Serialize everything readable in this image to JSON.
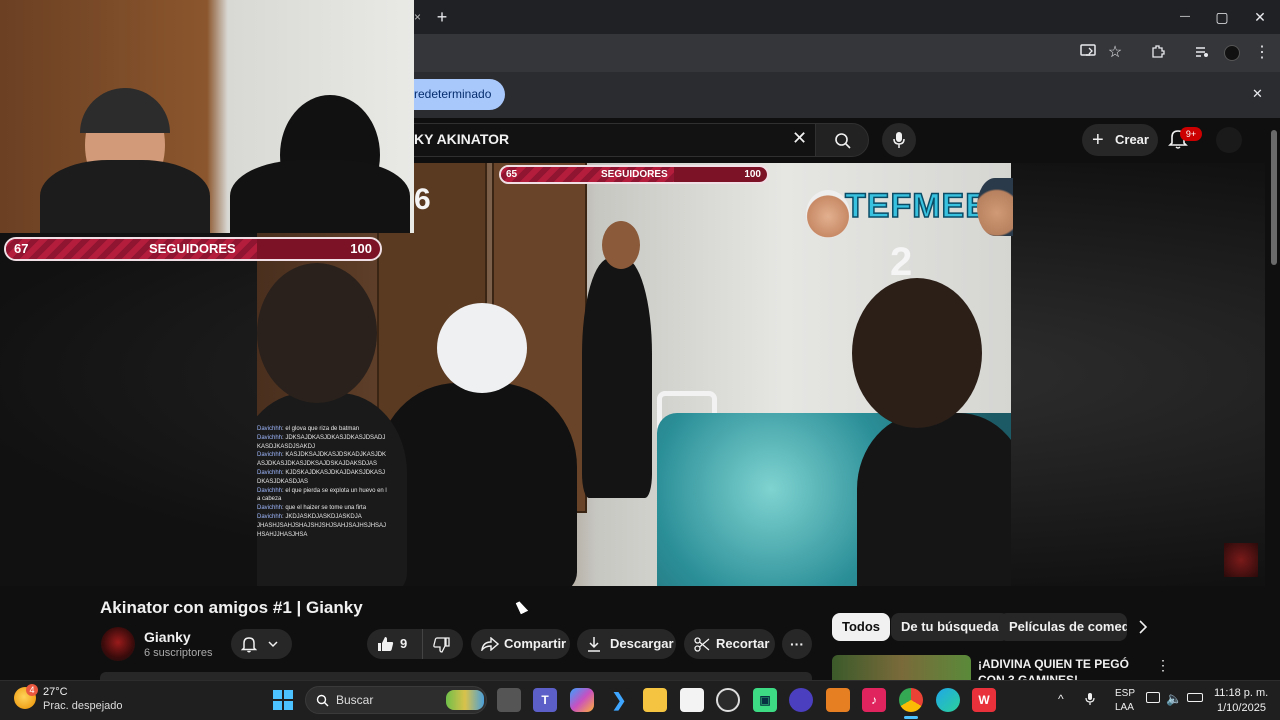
{
  "browser": {
    "new_tab_symbol": "+",
    "window_controls": {
      "minimize": "—",
      "maximize": "▢",
      "close": "✕"
    },
    "infobar_chip": "redeterminado",
    "infobar_close": "✕"
  },
  "youtube": {
    "search_query": "KY AKINATOR",
    "search_clear": "✕",
    "create_label": "Crear",
    "create_icon": "+",
    "notifications_badge": "9+"
  },
  "video": {
    "webcam_bar": {
      "left": "67",
      "label": "SEGUIDORES",
      "right": "100",
      "fill_fraction": 0.67
    },
    "scene_bar": {
      "left": "65",
      "label": "SEGUIDORES",
      "right": "100",
      "fill_fraction": 0.65
    },
    "overlay_tefmee": "TEFMEE",
    "overlay_2": "2",
    "overlay_6": "6",
    "chat": [
      {
        "name": "Davichhh",
        "msg": ": el glova que riza de batman"
      },
      {
        "name": "Davichhh",
        "msg": ": JDKSAJDKASJDKASJDKASJDSADJKASDJKASDJSAKDJ"
      },
      {
        "name": "Davichhh",
        "msg": ": KASJDKSAJDKASJDSKADJKASJDKASJDKASJDKASJDKSAJDSKAJDAKSDJAS"
      },
      {
        "name": "Davichhh",
        "msg": ": KJDSKAJDKASJDKAJDAKSJDKASJDKASJDKASDJAS"
      },
      {
        "name": "Davichhh",
        "msg": ": el que pierda se explota un huevo en la cabeza"
      },
      {
        "name": "Davichhh",
        "msg": ": que el haizer se tome una firta"
      },
      {
        "name": "Davichhh",
        "msg": ": JKDJASKDJASKDJASKDJA"
      },
      {
        "name": "",
        "msg": "JHASHJSAHJSHAJSHJSHJSAHJSAJHSJHSAJHSAHJJHASJHSA"
      }
    ]
  },
  "watch": {
    "title": "Akinator con amigos #1 | Gianky",
    "channel_name": "Gianky",
    "subscribers": "6 suscriptores",
    "like_count": "9",
    "share_label": "Compartir",
    "download_label": "Descargar",
    "clip_label": "Recortar",
    "more_label": "···"
  },
  "chips": [
    {
      "label": "Todos",
      "active": true
    },
    {
      "label": "De tu búsqueda",
      "active": false
    },
    {
      "label": "Películas de comedia",
      "active": false
    }
  ],
  "recommended": {
    "title": "¡ADIVINA QUIEN TE PEGÓ CON 3 GAMINES!"
  },
  "taskbar": {
    "weather_temp": "27°C",
    "weather_desc": "Prac. despejado",
    "weather_badge": "4",
    "search_placeholder": "Buscar",
    "lang_top": "ESP",
    "lang_bottom": "LAA",
    "time": "11:18 p. m.",
    "date": "1/10/2025"
  },
  "colors": {
    "accent_red": "#cc0000",
    "chip_blue": "#a8c7fa",
    "bar_red": "#7b1226"
  }
}
